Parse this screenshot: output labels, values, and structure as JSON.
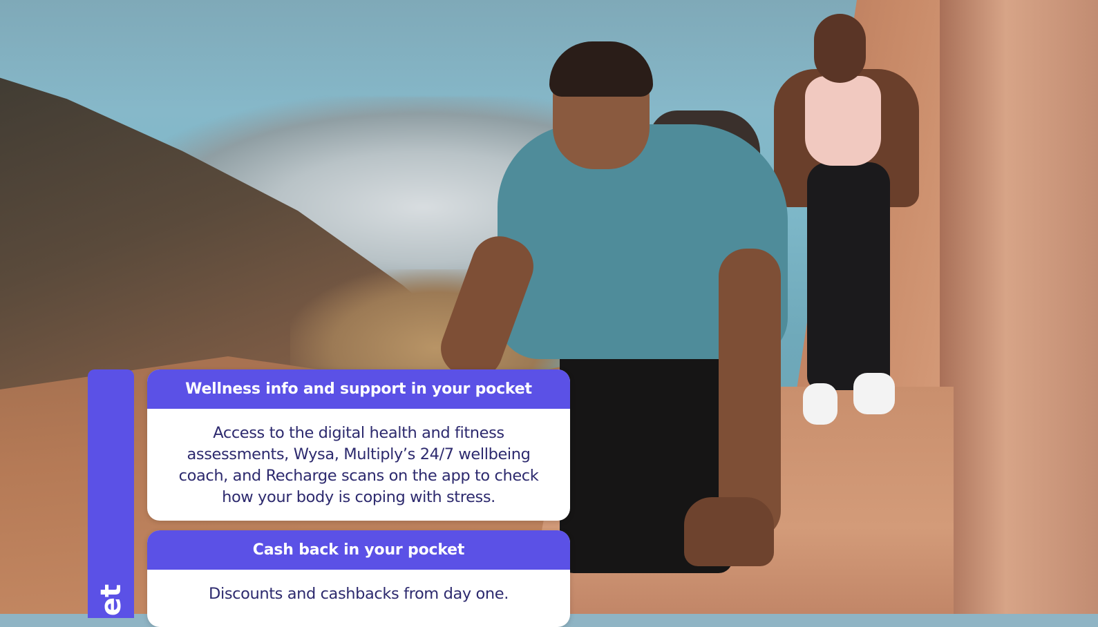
{
  "side_tab": {
    "label": "et"
  },
  "cards": [
    {
      "title": "Wellness info and support in your pocket",
      "body": "Access to the digital health and fitness assessments, Wysa, Multiply’s 24/7 wellbeing coach, and Recharge scans on the app to check how your body is coping with stress."
    },
    {
      "title": "Cash back in your pocket",
      "body": "Discounts and cashbacks from day one."
    }
  ],
  "colors": {
    "accent": "#5b51e6",
    "body_text": "#2d2a6e",
    "card_bg": "#ffffff"
  }
}
